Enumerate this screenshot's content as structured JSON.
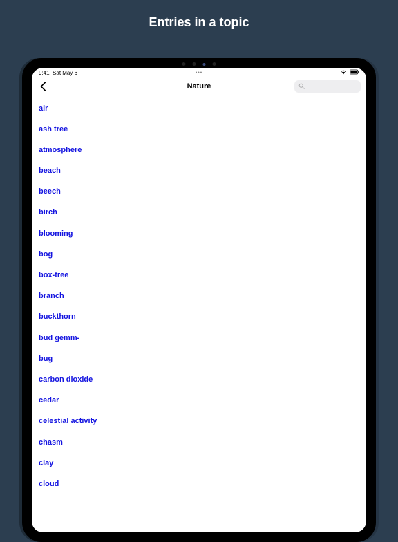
{
  "heading": "Entries in a topic",
  "status": {
    "time": "9:41",
    "date": "Sat May 6",
    "dots": "•••"
  },
  "nav": {
    "title": "Nature"
  },
  "entries": [
    "air",
    "ash tree",
    "atmosphere",
    "beach",
    "beech",
    "birch",
    "blooming",
    "bog",
    "box-tree",
    "branch",
    "buckthorn",
    "bud gemm-",
    "bug",
    "carbon dioxide",
    "cedar",
    "celestial activity",
    "chasm",
    "clay",
    "cloud"
  ]
}
